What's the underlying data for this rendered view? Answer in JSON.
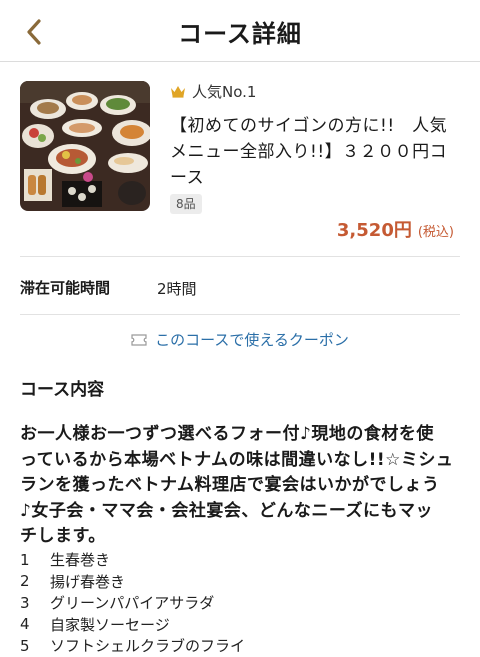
{
  "header": {
    "title": "コース詳細"
  },
  "course": {
    "rank": "人気No.1",
    "name_line1": "【初めてのサイゴンの方に!!　人気",
    "name_line2": "メニュー全部入り!!】３２００円コ",
    "name_line3": "ース",
    "items_badge": "8品",
    "price": "3,520円",
    "tax_note": "(税込)"
  },
  "stay": {
    "label": "滞在可能時間",
    "value": "2時間"
  },
  "coupon": {
    "label": "このコースで使えるクーポン"
  },
  "content": {
    "title": "コース内容",
    "description_lines": [
      "お一人様お一つずつ選べるフォー付♪現地の食材を使",
      "っているから本場ベトナムの味は間違いなし!!☆ミシュ",
      "ランを獲ったベトナム料理店で宴会はいかがでしょう",
      "♪女子会・ママ会・会社宴会、どんなニーズにもマッ",
      "チします。"
    ],
    "dishes": [
      {
        "num": "1",
        "name": "生春巻き"
      },
      {
        "num": "2",
        "name": "揚げ春巻き"
      },
      {
        "num": "3",
        "name": "グリーンパパイアサラダ"
      },
      {
        "num": "4",
        "name": "自家製ソーセージ"
      },
      {
        "num": "5",
        "name": "ソフトシェルクラブのフライ"
      }
    ]
  },
  "colors": {
    "price": "#c55a33",
    "link": "#2b6fa8",
    "crown": "#e0a526"
  }
}
